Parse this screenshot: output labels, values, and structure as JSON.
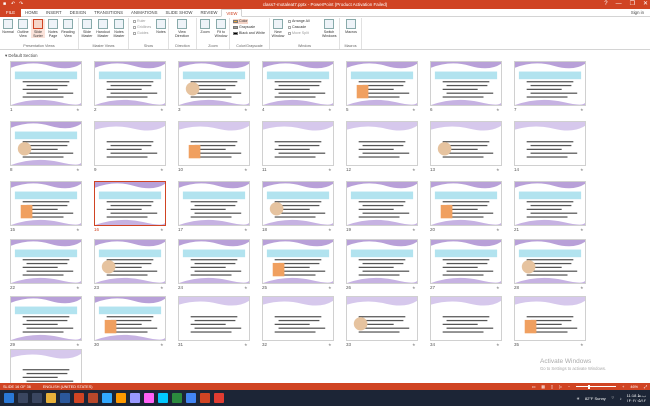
{
  "window": {
    "title": "class7-motaleat7.pptx - PowerPoint (Product Activation Failed)",
    "controls": [
      "?",
      "—",
      "❐",
      "✕"
    ]
  },
  "tabs": [
    {
      "label": "FILE"
    },
    {
      "label": "HOME"
    },
    {
      "label": "INSERT"
    },
    {
      "label": "DESIGN"
    },
    {
      "label": "TRANSITIONS"
    },
    {
      "label": "ANIMATIONS"
    },
    {
      "label": "SLIDE SHOW"
    },
    {
      "label": "REVIEW"
    },
    {
      "label": "VIEW"
    }
  ],
  "signin": "Sign in",
  "ribbon": {
    "presentation_views": {
      "label": "Presentation Views",
      "buttons": [
        "Normal",
        "Outline View",
        "Slide Sorter",
        "Notes Page",
        "Reading View"
      ]
    },
    "master_views": {
      "label": "Master Views",
      "buttons": [
        "Slide Master",
        "Handout Master",
        "Notes Master"
      ]
    },
    "show": {
      "label": "Show",
      "items": [
        "Ruler",
        "Gridlines",
        "Guides"
      ],
      "notes": "Notes"
    },
    "show_label": "Show",
    "zoom": {
      "label": "Zoom",
      "buttons": [
        "Zoom",
        "Fit to Window"
      ]
    },
    "direction": {
      "label": "Direction",
      "button": "View Direction"
    },
    "color": {
      "label": "Color/Grayscale",
      "items": [
        "Color",
        "Grayscale",
        "Black and White"
      ]
    },
    "window": {
      "label": "Window",
      "new": "New Window",
      "items": [
        "Arrange All",
        "Cascade",
        "Move Split"
      ],
      "switch": "Switch Windows"
    },
    "macros": {
      "label": "Macros",
      "button": "Macros"
    }
  },
  "section": "Default Section",
  "slides": [
    {
      "n": "1"
    },
    {
      "n": "2"
    },
    {
      "n": "3"
    },
    {
      "n": "4"
    },
    {
      "n": "5"
    },
    {
      "n": "6"
    },
    {
      "n": "7"
    },
    {
      "n": "8"
    },
    {
      "n": "9"
    },
    {
      "n": "10"
    },
    {
      "n": "11"
    },
    {
      "n": "12"
    },
    {
      "n": "13"
    },
    {
      "n": "14"
    },
    {
      "n": "15"
    },
    {
      "n": "16"
    },
    {
      "n": "17"
    },
    {
      "n": "18"
    },
    {
      "n": "19"
    },
    {
      "n": "20"
    },
    {
      "n": "21"
    },
    {
      "n": "22"
    },
    {
      "n": "23"
    },
    {
      "n": "24"
    },
    {
      "n": "25"
    },
    {
      "n": "26"
    },
    {
      "n": "27"
    },
    {
      "n": "28"
    },
    {
      "n": "29"
    },
    {
      "n": "30"
    },
    {
      "n": "31"
    },
    {
      "n": "32"
    },
    {
      "n": "33"
    },
    {
      "n": "34"
    },
    {
      "n": "35"
    },
    {
      "n": "36"
    }
  ],
  "selected_slide": "16",
  "activate": {
    "line1": "Activate Windows",
    "line2": "Go to Settings to activate Windows."
  },
  "status": {
    "slide": "SLIDE 16 OF 36",
    "lang": "ENGLISH (UNITED STATES)",
    "zoom": "46%"
  },
  "taskbar": {
    "weather": "82°F  Sunny",
    "time": "11:18 ب.ظ",
    "date": "۱۴۰۲/۰۵/۱۲"
  },
  "accent": "#d04423"
}
